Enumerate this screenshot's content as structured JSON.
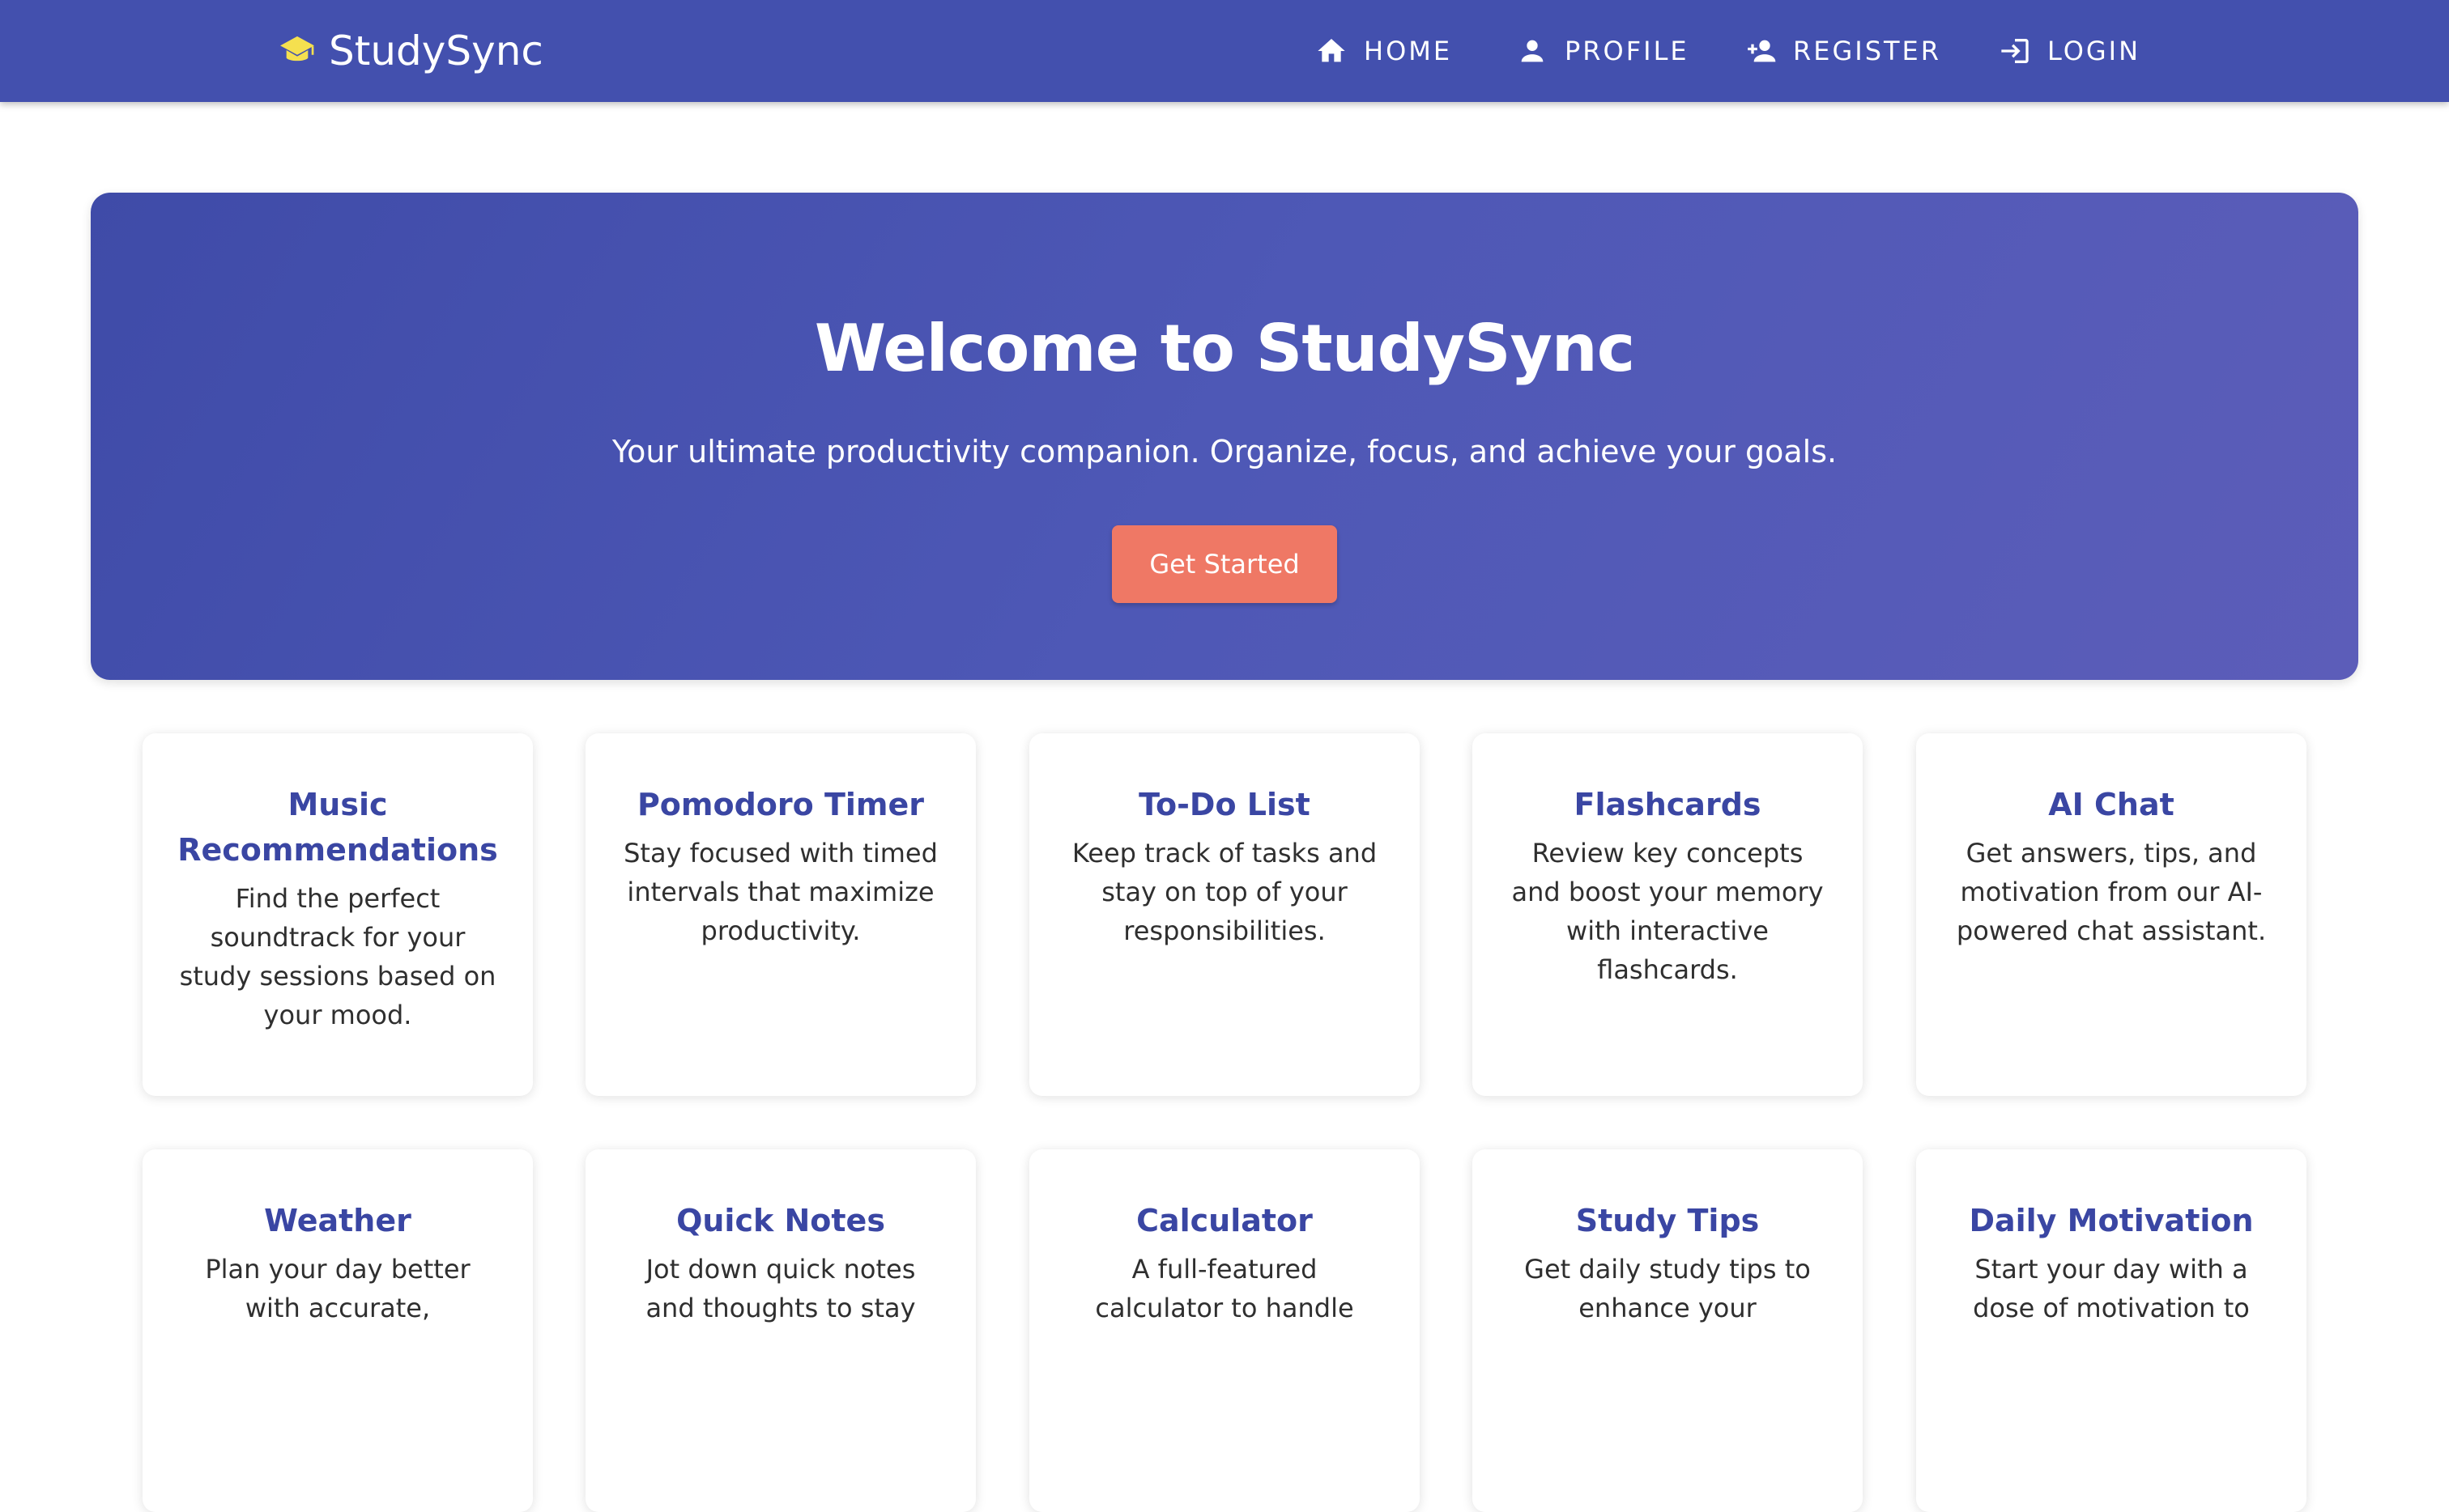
{
  "navbar": {
    "brand": "StudySync",
    "brand_icon": "graduation-cap-icon",
    "brand_icon_color": "#f5e04f",
    "background": "#4350ae",
    "items": [
      {
        "label": "HOME",
        "icon": "home-icon"
      },
      {
        "label": "PROFILE",
        "icon": "person-icon"
      },
      {
        "label": "REGISTER",
        "icon": "person-add-icon"
      },
      {
        "label": "LOGIN",
        "icon": "login-icon"
      }
    ]
  },
  "hero": {
    "title": "Welcome to StudySync",
    "subtitle": "Your ultimate productivity companion. Organize, focus, and achieve your goals.",
    "cta_label": "Get Started",
    "cta_color": "#ef7865"
  },
  "features": [
    {
      "title": "Music Recommendations",
      "description": "Find the perfect soundtrack for your study sessions based on your mood."
    },
    {
      "title": "Pomodoro Timer",
      "description": "Stay focused with timed intervals that maximize productivity."
    },
    {
      "title": "To-Do List",
      "description": "Keep track of tasks and stay on top of your responsibilities."
    },
    {
      "title": "Flashcards",
      "description": "Review key concepts and boost your memory with interactive flashcards."
    },
    {
      "title": "AI Chat",
      "description": "Get answers, tips, and motivation from our AI-powered chat assistant."
    },
    {
      "title": "Weather",
      "description": "Plan your day better with accurate,"
    },
    {
      "title": "Quick Notes",
      "description": "Jot down quick notes and thoughts to stay"
    },
    {
      "title": "Calculator",
      "description": "A full-featured calculator to handle"
    },
    {
      "title": "Study Tips",
      "description": "Get daily study tips to enhance your"
    },
    {
      "title": "Daily Motivation",
      "description": "Start your day with a dose of motivation to"
    }
  ],
  "theme": {
    "accent": "#3a46a3",
    "card_background": "#ffffff"
  }
}
